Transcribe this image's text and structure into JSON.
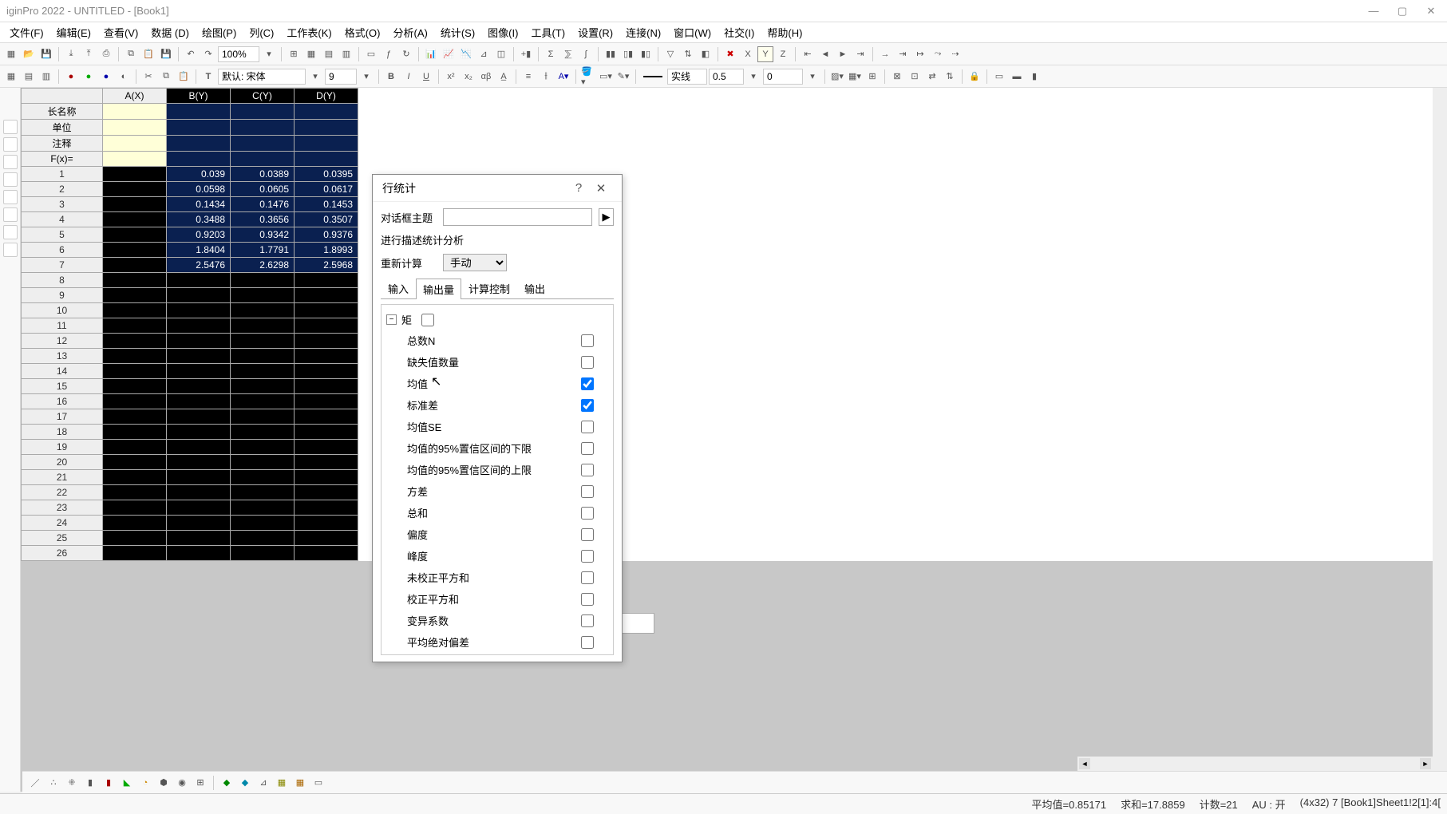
{
  "title": "iginPro 2022 - UNTITLED - [Book1]",
  "menus": [
    "文件(F)",
    "编辑(E)",
    "查看(V)",
    "数据 (D)",
    "绘图(P)",
    "列(C)",
    "工作表(K)",
    "格式(O)",
    "分析(A)",
    "统计(S)",
    "图像(I)",
    "工具(T)",
    "设置(R)",
    "连接(N)",
    "窗口(W)",
    "社交(I)",
    "帮助(H)"
  ],
  "zoom": "100%",
  "font_label": "默认: 宋体",
  "font_size": "9",
  "line_style": "实线",
  "line_width": "0.5",
  "num1": "0",
  "columns": [
    "A(X)",
    "B(Y)",
    "C(Y)",
    "D(Y)"
  ],
  "row_labels": [
    "长名称",
    "单位",
    "注释",
    "F(x)="
  ],
  "data": [
    {
      "n": "1",
      "b": "0.039",
      "c": "0.0389",
      "d": "0.0395"
    },
    {
      "n": "2",
      "b": "0.0598",
      "c": "0.0605",
      "d": "0.0617"
    },
    {
      "n": "3",
      "b": "0.1434",
      "c": "0.1476",
      "d": "0.1453"
    },
    {
      "n": "4",
      "b": "0.3488",
      "c": "0.3656",
      "d": "0.3507"
    },
    {
      "n": "5",
      "b": "0.9203",
      "c": "0.9342",
      "d": "0.9376"
    },
    {
      "n": "6",
      "b": "1.8404",
      "c": "1.7791",
      "d": "1.8993"
    },
    {
      "n": "7",
      "b": "2.5476",
      "c": "2.6298",
      "d": "2.5968"
    }
  ],
  "empty_rows": [
    "8",
    "9",
    "10",
    "11",
    "12",
    "13",
    "14",
    "15",
    "16",
    "17",
    "18",
    "19",
    "20",
    "21",
    "22",
    "23",
    "24",
    "25",
    "26"
  ],
  "sheet_name": "Sheet1",
  "dialog": {
    "title": "行统计",
    "theme_label": "对话框主题",
    "desc": "进行描述统计分析",
    "recalc_label": "重新计算",
    "recalc_value": "手动",
    "tabs": [
      "输入",
      "输出量",
      "计算控制",
      "输出"
    ],
    "active_tab": 1,
    "tree_root": "矩",
    "options": [
      {
        "label": "总数N",
        "checked": false
      },
      {
        "label": "缺失值数量",
        "checked": false
      },
      {
        "label": "均值",
        "checked": true
      },
      {
        "label": "标准差",
        "checked": true
      },
      {
        "label": "均值SE",
        "checked": false
      },
      {
        "label": "均值的95%置信区间的下限",
        "checked": false
      },
      {
        "label": "均值的95%置信区间的上限",
        "checked": false
      },
      {
        "label": "方差",
        "checked": false
      },
      {
        "label": "总和",
        "checked": false
      },
      {
        "label": "偏度",
        "checked": false
      },
      {
        "label": "峰度",
        "checked": false
      },
      {
        "label": "未校正平方和",
        "checked": false
      },
      {
        "label": "校正平方和",
        "checked": false
      },
      {
        "label": "变异系数",
        "checked": false
      },
      {
        "label": "平均绝对偏差",
        "checked": false
      }
    ]
  },
  "status": {
    "mean": "平均值=0.85171",
    "sum": "求和=17.8859",
    "count": "计数=21",
    "au": "AU : 开",
    "sel": "(4x32) 7 [Book1]Sheet1!2[1]:4["
  }
}
